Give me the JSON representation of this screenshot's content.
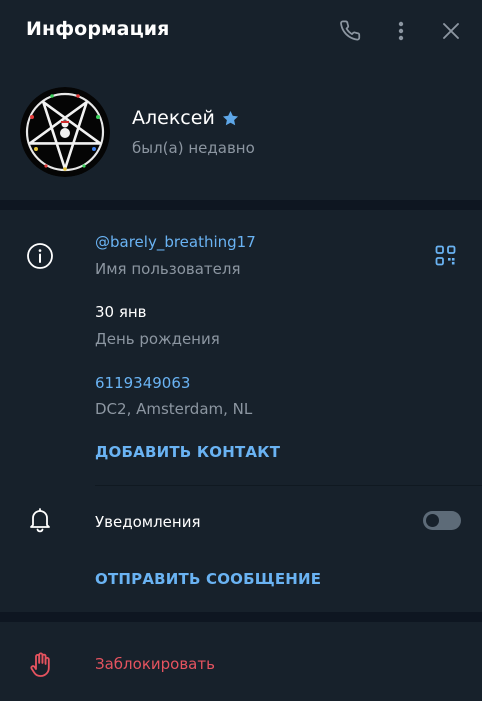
{
  "header": {
    "title": "Информация"
  },
  "profile": {
    "name": "Алексей",
    "status": "был(а) недавно"
  },
  "info": {
    "username": "@barely_breathing17",
    "username_label": "Имя пользователя",
    "birthday": "30 янв",
    "birthday_label": "День рождения",
    "id": "6119349063",
    "datacenter": "DC2, Amsterdam, NL",
    "add_contact_label": "ДОБАВИТЬ КОНТАКТ"
  },
  "notifications": {
    "label": "Уведомления",
    "enabled": false
  },
  "send_message_label": "ОТПРАВИТЬ СООБЩЕНИЕ",
  "block_label": "Заблокировать",
  "icons": {
    "call": "phone-icon",
    "more": "more-vertical-icon",
    "close": "close-icon",
    "star": "star-icon",
    "info": "info-icon",
    "qr": "qr-code-icon",
    "notifications": "bell-icon",
    "block": "hand-icon"
  },
  "colors": {
    "background": "#17212b",
    "band": "#0e1621",
    "accent": "#6ab3f3",
    "secondary_text": "#8c96a1",
    "danger": "#e5535f",
    "star": "#5ea7e8"
  }
}
